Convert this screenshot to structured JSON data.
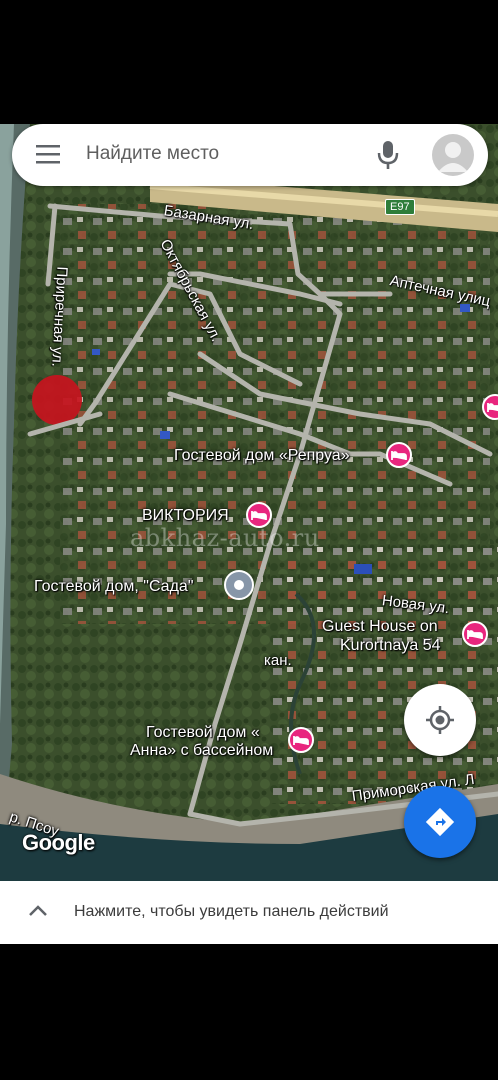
{
  "search": {
    "placeholder": "Найдите место"
  },
  "streets": {
    "bazarnaya": "Базарная ул.",
    "oktyabrskaya": "Октябрьская ул.",
    "aptechnaya": "Аптечная улиц",
    "prirechnaya": "Приречная ул.",
    "novaya": "Новая ул.",
    "primorskaya": "Приморская ул. Л",
    "kan": "кан.",
    "river": "р. Псоу",
    "highway": "E97"
  },
  "places": [
    {
      "name": "Гостевой дом «Репруа»"
    },
    {
      "name": "ВИКТОРИЯ"
    },
    {
      "name": "Гостевой дом, \"Сада\""
    },
    {
      "name_line1": "Guest House on",
      "name_line2": "Kurortnaya 54"
    },
    {
      "name_line1": "Гостевой дом «",
      "name_line2": "Анна» с бассейном"
    }
  ],
  "watermark": "abkhaz-auto.ru",
  "google_logo": "Google",
  "bottom_panel": {
    "text": "Нажмите, чтобы увидеть панель действий"
  },
  "colors": {
    "poi_pin": "#e8267e",
    "directions_fab": "#1a73e8",
    "marker_red": "#c8141e"
  },
  "icons": [
    "menu-icon",
    "mic-icon",
    "avatar-icon",
    "lodging-icon",
    "my-location-icon",
    "directions-icon",
    "chevron-up-icon"
  ]
}
